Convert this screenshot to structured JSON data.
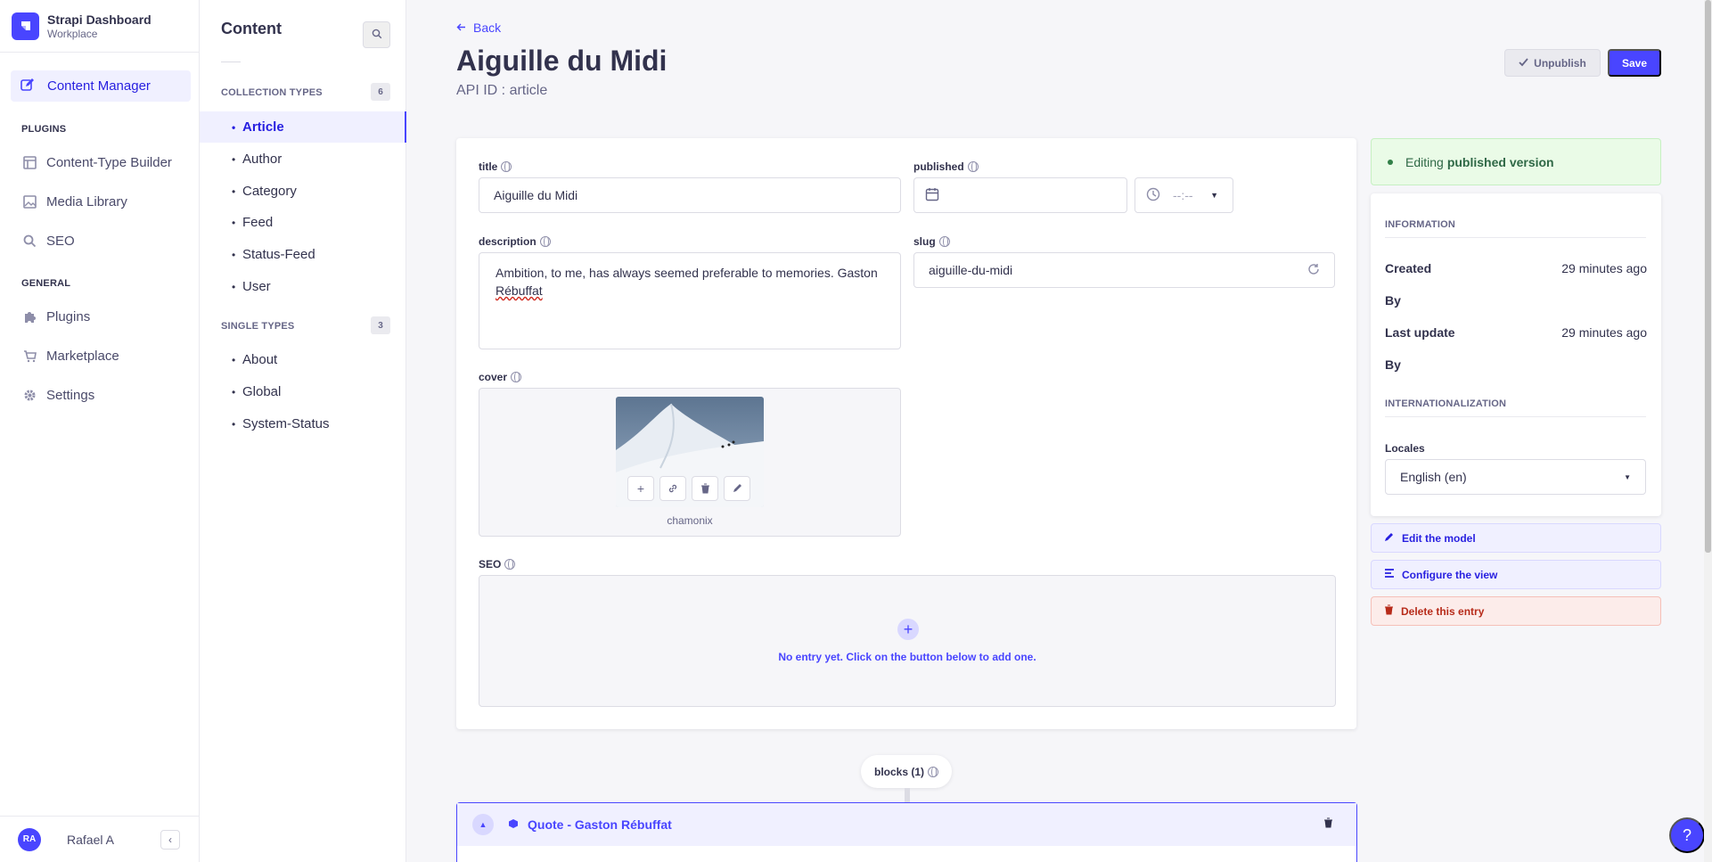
{
  "brand": {
    "title": "Strapi Dashboard",
    "subtitle": "Workplace"
  },
  "mainnav": {
    "active_item": "Content Manager",
    "plugins_header": "PLUGINS",
    "plugins": [
      "Content-Type Builder",
      "Media Library",
      "SEO"
    ],
    "general_header": "GENERAL",
    "general": [
      "Plugins",
      "Marketplace",
      "Settings"
    ],
    "user": {
      "initials": "RA",
      "name": "Rafael A"
    }
  },
  "subnav": {
    "title": "Content",
    "collection_header": "COLLECTION TYPES",
    "collection_count": "6",
    "collection_items": [
      "Article",
      "Author",
      "Category",
      "Feed",
      "Status-Feed",
      "User"
    ],
    "single_header": "SINGLE TYPES",
    "single_count": "3",
    "single_items": [
      "About",
      "Global",
      "System-Status"
    ]
  },
  "header": {
    "back": "Back",
    "title": "Aiguille du Midi",
    "api_id": "API ID : article",
    "unpublish": "Unpublish",
    "save": "Save"
  },
  "form": {
    "title_label": "title",
    "title_value": "Aiguille du Midi",
    "published_label": "published",
    "time_placeholder": "--:--",
    "description_label": "description",
    "description_value_1": "Ambition, to me, has always seemed preferable to memories. Gaston",
    "description_value_2": "Rébuffat",
    "slug_label": "slug",
    "slug_value": "aiguille-du-midi",
    "cover_label": "cover",
    "cover_caption": "chamonix",
    "seo_label": "SEO",
    "seo_empty": "No entry yet. Click on the button below to add one."
  },
  "panel": {
    "status_prefix": "Editing",
    "status_bold": "published version",
    "information_header": "INFORMATION",
    "created_key": "Created",
    "created_val": "29 minutes ago",
    "by_key_1": "By",
    "updated_key": "Last update",
    "updated_val": "29 minutes ago",
    "by_key_2": "By",
    "i18n_header": "INTERNATIONALIZATION",
    "locales_label": "Locales",
    "locale_value": "English (en)",
    "edit_model": "Edit the model",
    "configure_view": "Configure the view",
    "delete_entry": "Delete this entry"
  },
  "blocks": {
    "pill": "blocks (1)",
    "item_title": "Quote - Gaston Rébuffat"
  },
  "help": "?",
  "colors": {
    "primary": "#4945ff",
    "success_bg": "#eafbe7",
    "danger": "#b72b1a"
  }
}
